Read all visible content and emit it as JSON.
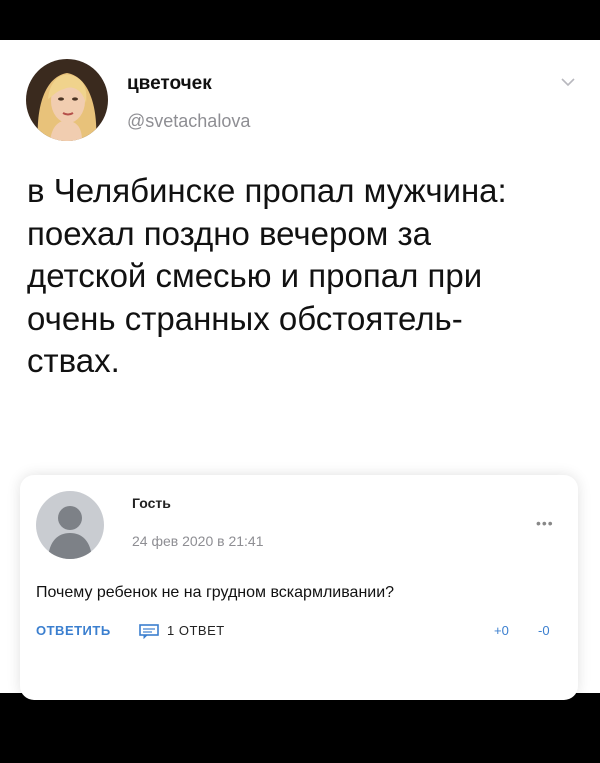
{
  "post": {
    "author_name": "цветочек",
    "author_handle": "@svetachalova",
    "avatar_icon": "user-photo-avatar",
    "text_lines": [
      "в Челябинске пропал мужчина:",
      "поехал поздно вечером за",
      "детской смесью и пропал при",
      "очень странных обстоятель-",
      "ствах."
    ]
  },
  "comment": {
    "author_name": "Гость",
    "date": "24 фев 2020 в 21:41",
    "more_label": "•••",
    "text": "Почему ребенок не на грудном вскармливании?",
    "reply_label": "ОТВЕТИТЬ",
    "reply_count_label": "1 ОТВЕТ",
    "votes_up": "+0",
    "votes_down": "-0"
  },
  "colors": {
    "link_blue": "#3b7fcf",
    "secondary_text": "#8e8e93",
    "background": "#000000",
    "card": "#ffffff"
  }
}
